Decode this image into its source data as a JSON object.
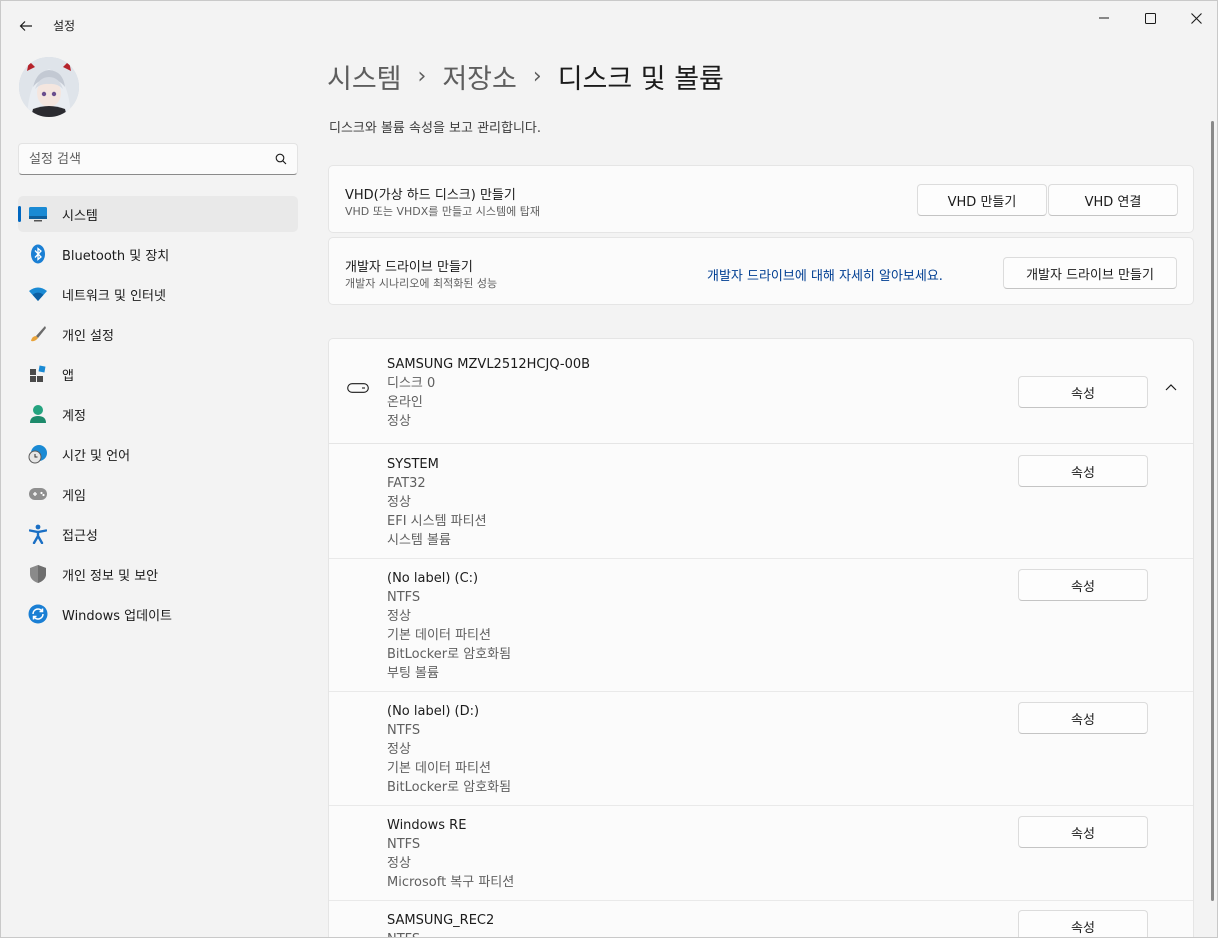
{
  "window": {
    "app_title": "설정"
  },
  "sidebar": {
    "search_placeholder": "설정 검색",
    "items": [
      {
        "label": "시스템",
        "icon": "system-icon",
        "active": true
      },
      {
        "label": "Bluetooth 및 장치",
        "icon": "bluetooth-icon"
      },
      {
        "label": "네트워크 및 인터넷",
        "icon": "wifi-icon"
      },
      {
        "label": "개인 설정",
        "icon": "brush-icon"
      },
      {
        "label": "앱",
        "icon": "apps-icon"
      },
      {
        "label": "계정",
        "icon": "account-icon"
      },
      {
        "label": "시간 및 언어",
        "icon": "time-language-icon"
      },
      {
        "label": "게임",
        "icon": "gamepad-icon"
      },
      {
        "label": "접근성",
        "icon": "accessibility-icon"
      },
      {
        "label": "개인 정보 및 보안",
        "icon": "shield-icon"
      },
      {
        "label": "Windows 업데이트",
        "icon": "update-icon"
      }
    ]
  },
  "header": {
    "crumb1": "시스템",
    "crumb2": "저장소",
    "current": "디스크 및 볼륨",
    "separator": "›",
    "description": "디스크와 볼륨 속성을 보고 관리합니다."
  },
  "vhd_card": {
    "title": "VHD(가상 하드 디스크) 만들기",
    "subtitle": "VHD 또는 VHDX를 만들고 시스템에 탑재",
    "create_label": "VHD 만들기",
    "attach_label": "VHD 연결"
  },
  "devdrive_card": {
    "title": "개발자 드라이브 만들기",
    "subtitle": "개발자 시나리오에 최적화된 성능",
    "link": "개발자 드라이브에 대해 자세히 알아보세요.",
    "button_label": "개발자 드라이브 만들기"
  },
  "disk": {
    "name": "SAMSUNG MZVL2512HCJQ-00B",
    "lines": [
      "디스크 0",
      "온라인",
      "정상"
    ],
    "properties_label": "속성"
  },
  "partitions": [
    {
      "name": "SYSTEM",
      "lines": [
        "FAT32",
        "정상",
        "EFI 시스템 파티션",
        "시스템 볼륨"
      ],
      "properties_label": "속성"
    },
    {
      "name": "(No label) (C:)",
      "lines": [
        "NTFS",
        "정상",
        "기본 데이터 파티션",
        "BitLocker로 암호화됨",
        "부팅 볼륨"
      ],
      "properties_label": "속성"
    },
    {
      "name": "(No label) (D:)",
      "lines": [
        "NTFS",
        "정상",
        "기본 데이터 파티션",
        "BitLocker로 암호화됨"
      ],
      "properties_label": "속성"
    },
    {
      "name": "Windows RE",
      "lines": [
        "NTFS",
        "정상",
        "Microsoft 복구 파티션"
      ],
      "properties_label": "속성"
    },
    {
      "name": "SAMSUNG_REC2",
      "lines": [
        "NTFS"
      ],
      "properties_label": "속성"
    }
  ],
  "colors": {
    "accent": "#0067c0",
    "link": "#003e92",
    "background": "#f3f3f3"
  }
}
